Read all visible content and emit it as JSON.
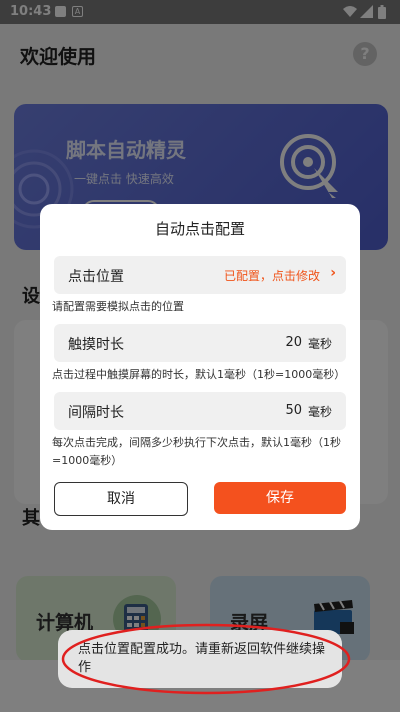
{
  "status_bar": {
    "time": "10:43"
  },
  "page": {
    "title": "欢迎使用",
    "help_icon": "?",
    "banner": {
      "title": "脚本自动精灵",
      "subtitle": "一键点击  快速高效"
    },
    "section_a_title": "设",
    "section_b_title": "其",
    "cards": [
      {
        "label": "计算机"
      },
      {
        "label": "录屏"
      }
    ]
  },
  "dialog": {
    "title": "自动点击配置",
    "position_row": {
      "label": "点击位置",
      "status": "已配置，点击修改"
    },
    "position_hint": "请配置需要模拟点击的位置",
    "touch_row": {
      "label": "触摸时长",
      "value": "20",
      "unit": "毫秒"
    },
    "touch_hint": "点击过程中触摸屏幕的时长，默认1毫秒（1秒=1000毫秒）",
    "interval_row": {
      "label": "间隔时长",
      "value": "50",
      "unit": "毫秒"
    },
    "interval_hint": "每次点击完成，间隔多少秒执行下次点击，默认1毫秒（1秒=1000毫秒）",
    "cancel_label": "取消",
    "save_label": "保存"
  },
  "toast": {
    "text": "点击位置配置成功。请重新返回软件继续操作"
  },
  "colors": {
    "accent": "#f4511e",
    "status_text": "#f0541a",
    "annotation": "#e0201f"
  }
}
